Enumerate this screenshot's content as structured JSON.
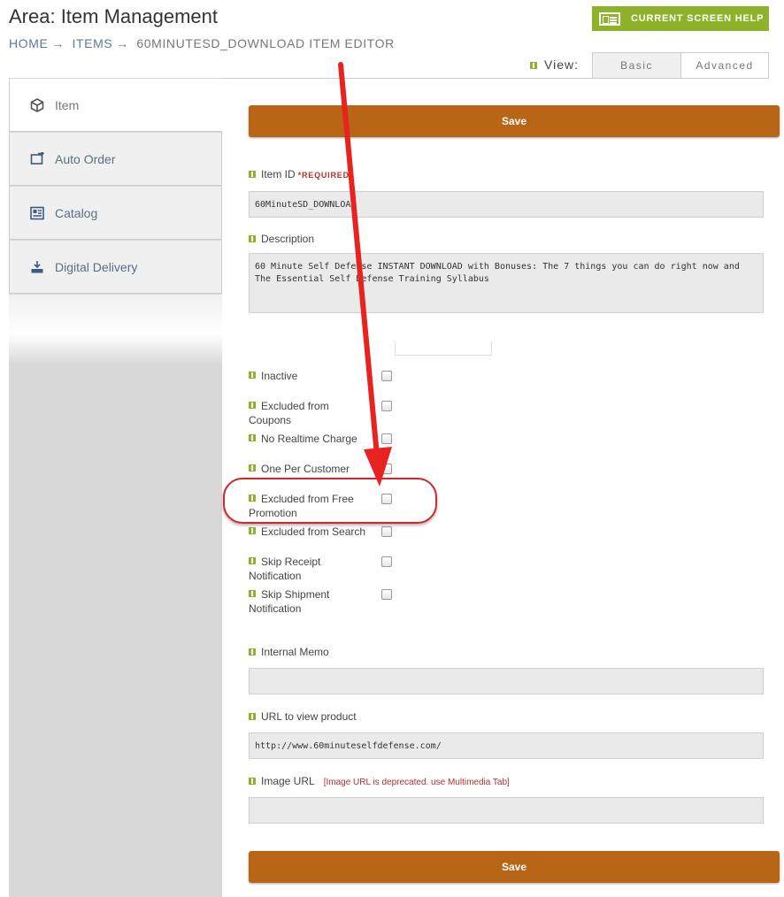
{
  "header": {
    "title": "Area: Item Management",
    "breadcrumb": [
      "HOME",
      "ITEMS",
      "60MINUTESD_DOWNLOAD ITEM EDITOR"
    ],
    "breadcrumb_separator": "→",
    "help_button": "CURRENT SCREEN HELP"
  },
  "view": {
    "label": "View:",
    "tabs": [
      "Basic",
      "Advanced"
    ],
    "selected": "Advanced"
  },
  "sidebar": {
    "items": [
      {
        "label": "Item",
        "icon": "cube-icon",
        "active": true
      },
      {
        "label": "Auto Order",
        "icon": "auto-order-icon",
        "active": false
      },
      {
        "label": "Catalog",
        "icon": "catalog-icon",
        "active": false
      },
      {
        "label": "Digital Delivery",
        "icon": "download-tray-icon",
        "active": false
      }
    ]
  },
  "form": {
    "save_label": "Save",
    "item_id": {
      "label": "Item ID",
      "required": "*REQUIRED",
      "value": "60MinuteSD_DOWNLOAD"
    },
    "description": {
      "label": "Description",
      "value": "60 Minute Self Defense INSTANT DOWNLOAD with Bonuses: The 7 things you can do right now and The Essential Self Defense Training Syllabus"
    },
    "checkboxes": [
      {
        "label": "Inactive",
        "checked": false
      },
      {
        "label": "Excluded from Coupons",
        "checked": false
      },
      {
        "label": "No Realtime Charge",
        "checked": false
      },
      {
        "label": "One Per Customer",
        "checked": false
      },
      {
        "label": "Excluded from Free Promotion",
        "checked": false
      },
      {
        "label": "Excluded from Search",
        "checked": false
      },
      {
        "label": "Skip Receipt Notification",
        "checked": false
      },
      {
        "label": "Skip Shipment Notification",
        "checked": false
      }
    ],
    "internal_memo": {
      "label": "Internal Memo",
      "value": ""
    },
    "url_to_view": {
      "label": "URL to view product",
      "value": "http://www.60minuteselfdefense.com/"
    },
    "image_url": {
      "label": "Image URL",
      "note": "[Image URL is deprecated. use Multimedia Tab]",
      "value": ""
    }
  },
  "annotation": {
    "color": "#e8221f"
  },
  "colors": {
    "accent_green": "#8db32a",
    "save_orange": "#b86515",
    "link_blue": "#5d7a99"
  }
}
